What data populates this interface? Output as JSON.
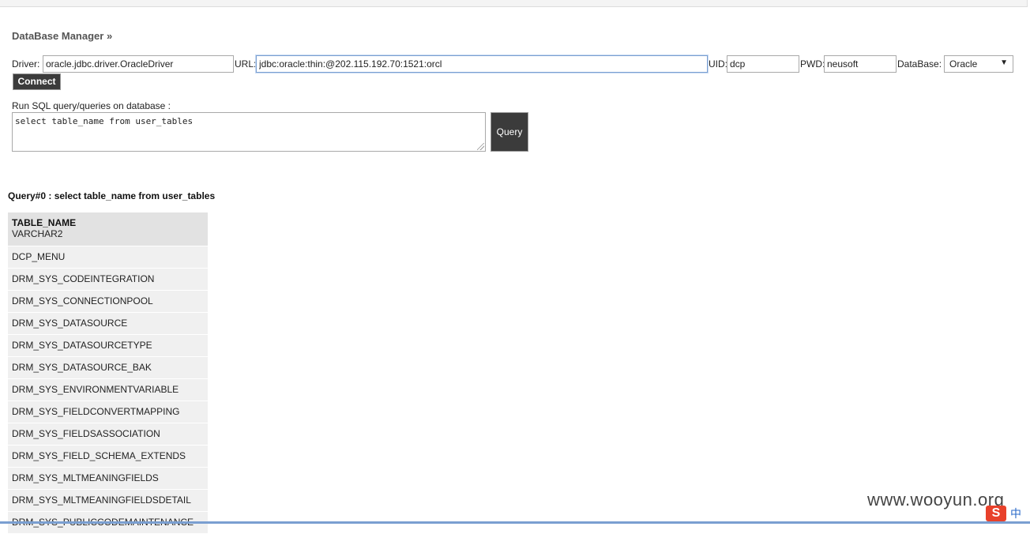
{
  "title": "DataBase Manager »",
  "connection": {
    "driver_label": "Driver:",
    "driver_value": "oracle.jdbc.driver.OracleDriver",
    "url_label": "URL:",
    "url_value": "jdbc:oracle:thin:@202.115.192.70:1521:orcl",
    "uid_label": "UID:",
    "uid_value": "dcp",
    "pwd_label": "PWD:",
    "pwd_value": "neusoft",
    "database_label": "DataBase:",
    "database_selected": "Oracle",
    "connect_label": "Connect"
  },
  "sql": {
    "prompt": "Run SQL query/queries on database :",
    "query_text": "select table_name from user_tables",
    "query_button": "Query"
  },
  "result": {
    "heading": "Query#0 : select table_name from user_tables",
    "column_name": "TABLE_NAME",
    "column_type": "VARCHAR2",
    "rows": [
      "DCP_MENU",
      "DRM_SYS_CODEINTEGRATION",
      "DRM_SYS_CONNECTIONPOOL",
      "DRM_SYS_DATASOURCE",
      "DRM_SYS_DATASOURCETYPE",
      "DRM_SYS_DATASOURCE_BAK",
      "DRM_SYS_ENVIRONMENTVARIABLE",
      "DRM_SYS_FIELDCONVERTMAPPING",
      "DRM_SYS_FIELDSASSOCIATION",
      "DRM_SYS_FIELD_SCHEMA_EXTENDS",
      "DRM_SYS_MLTMEANINGFIELDS",
      "DRM_SYS_MLTMEANINGFIELDSDETAIL",
      "DRM_SYS_PUBLICCODEMAINTENANCE"
    ]
  },
  "watermark": "www.wooyun.org",
  "ime": {
    "logo": "S",
    "mode": "中"
  },
  "icons": {
    "dropdown": "chevron-down-icon",
    "ime": "sogou-ime-icon"
  }
}
